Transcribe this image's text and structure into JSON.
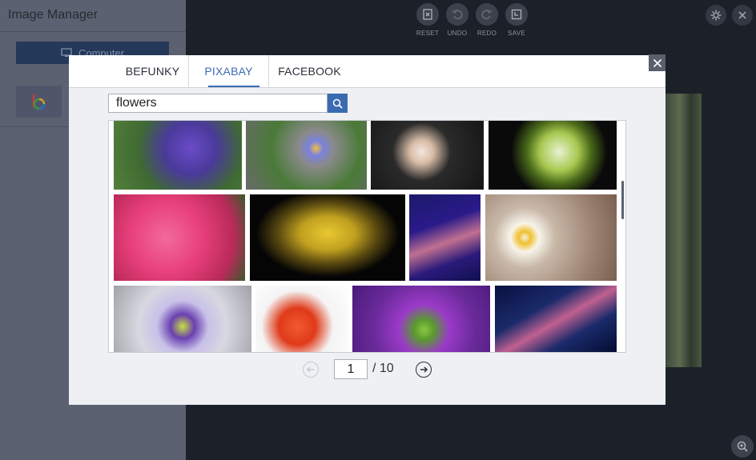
{
  "sidebar": {
    "title": "Image Manager",
    "computer_label": "Computer",
    "source_icon": "befunky-logo-icon"
  },
  "toolbar": {
    "items": [
      {
        "label": "RESET",
        "icon": "reset-icon"
      },
      {
        "label": "UNDO",
        "icon": "undo-icon"
      },
      {
        "label": "REDO",
        "icon": "redo-icon"
      },
      {
        "label": "SAVE",
        "icon": "save-icon"
      }
    ]
  },
  "modal": {
    "tabs": [
      {
        "label": "BEFUNKY",
        "active": false
      },
      {
        "label": "PIXABAY",
        "active": true
      },
      {
        "label": "FACEBOOK",
        "active": false
      }
    ],
    "search": {
      "value": "flowers"
    },
    "images": [
      "purple-primrose-thumbnail",
      "blue-daisy-thumbnail",
      "cherry-blossom-thumbnail",
      "green-tulip-bud-thumbnail",
      "pink-azalea-thumbnail",
      "yellow-ixora-thumbnail",
      "pink-grass-flower-thumbnail",
      "daisies-on-wood-thumbnail",
      "passion-flower-thumbnail",
      "red-lily-thumbnail",
      "purple-allium-thumbnail",
      "pink-grass-flower-dark-thumbnail"
    ],
    "pagination": {
      "current": "1",
      "total": "/ 10"
    }
  },
  "colors": {
    "accent": "#3c6ab0",
    "sidebar_bg": "#5b6170",
    "app_bg": "#1c2129"
  }
}
